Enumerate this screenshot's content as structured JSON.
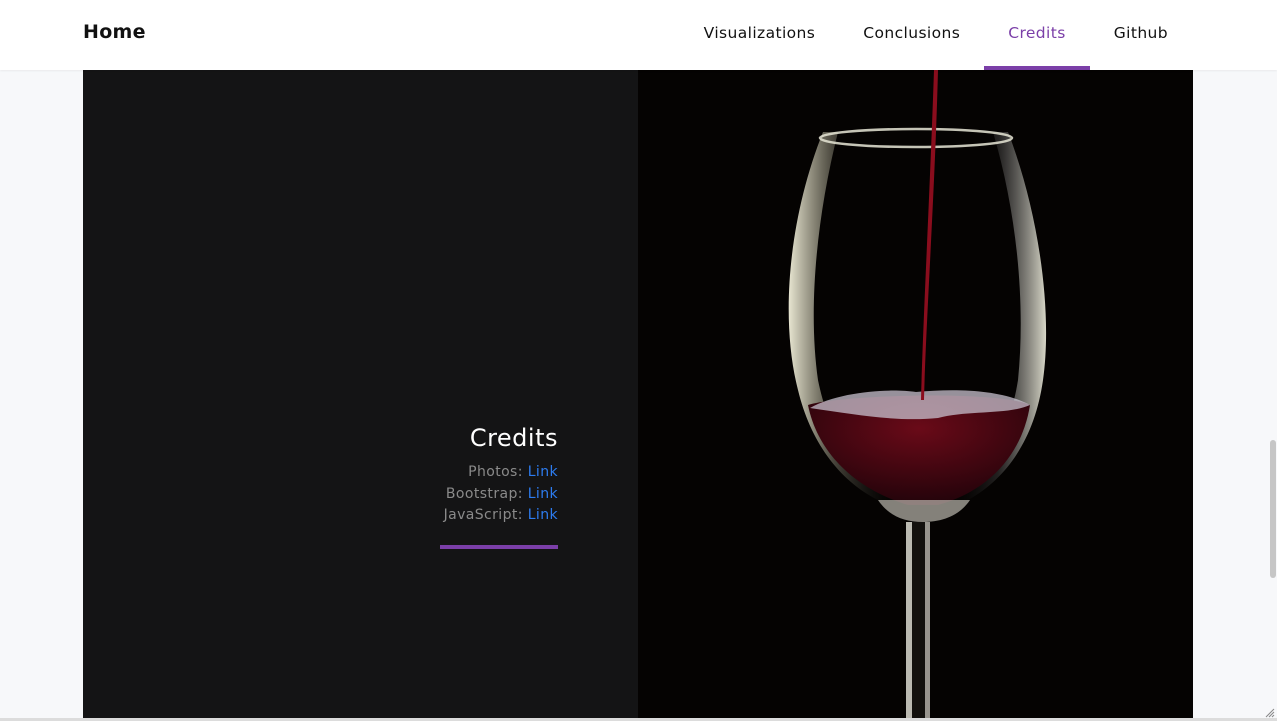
{
  "navbar": {
    "brand": "Home",
    "links": [
      {
        "label": "Visualizations",
        "active": false
      },
      {
        "label": "Conclusions",
        "active": false
      },
      {
        "label": "Credits",
        "active": true
      },
      {
        "label": "Github",
        "active": false
      }
    ]
  },
  "credits": {
    "title": "Credits",
    "items": [
      {
        "label": "Photos:",
        "link": "Link"
      },
      {
        "label": "Bootstrap:",
        "link": "Link"
      },
      {
        "label": "JavaScript:",
        "link": "Link"
      }
    ]
  },
  "colors": {
    "accent": "#7b3fa8",
    "link": "#2d7cf0",
    "panel_dark": "#141415"
  }
}
